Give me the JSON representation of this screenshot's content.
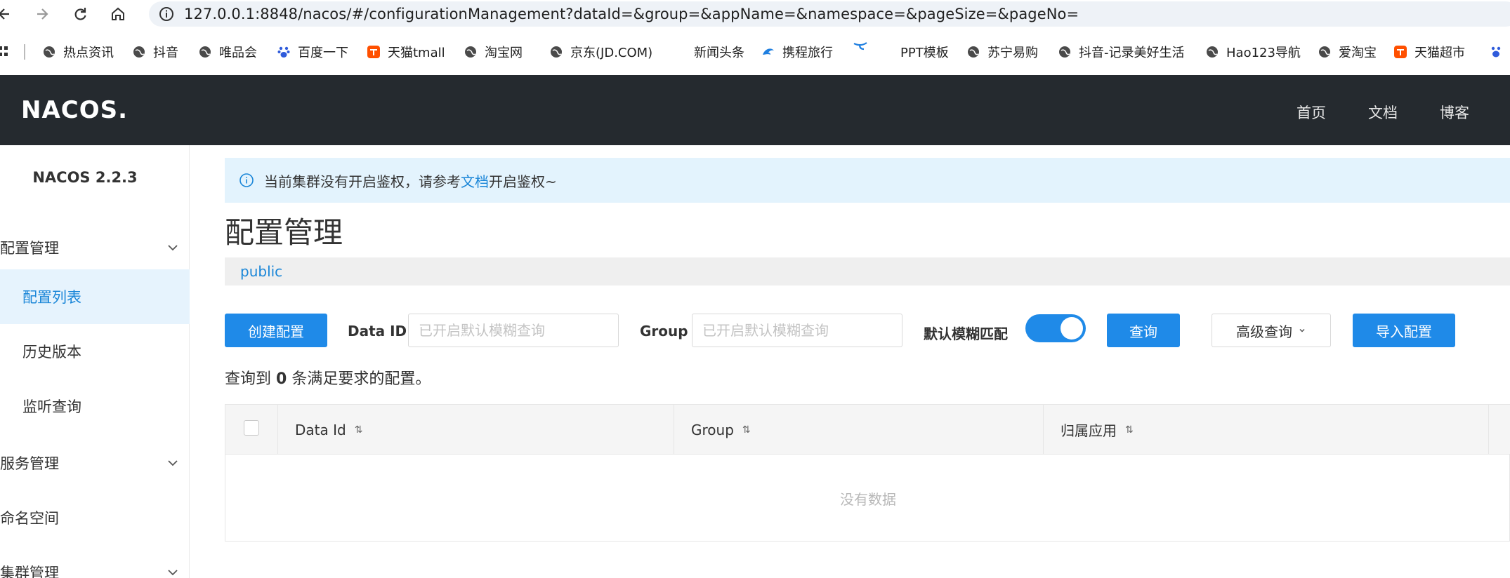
{
  "browser": {
    "url": "127.0.0.1:8848/nacos/#/configurationManagement?dataId=&group=&appName=&namespace=&pageSize=&pageNo=",
    "bookmarks": [
      "热点资讯",
      "抖音",
      "唯品会",
      "百度一下",
      "天猫tmall",
      "淘宝网",
      "京东(JD.COM)",
      "新闻头条",
      "携程旅行",
      "PPT模板",
      "苏宁易购",
      "抖音-记录美好生活",
      "Hao123导航",
      "爱淘宝",
      "天猫超市"
    ]
  },
  "header": {
    "logo": "NACOS.",
    "links": [
      "首页",
      "文档",
      "博客"
    ]
  },
  "sidebar": {
    "title": "NACOS 2.2.3",
    "sections": [
      {
        "label": "配置管理",
        "expanded": true
      },
      {
        "label": "服务管理",
        "expanded": false
      },
      {
        "label": "命名空间"
      },
      {
        "label": "集群管理",
        "expanded": false
      }
    ],
    "items": [
      "配置列表",
      "历史版本",
      "监听查询"
    ]
  },
  "notice": {
    "prefix": "当前集群没有开启鉴权，请参考",
    "link": "文档",
    "suffix": "开启鉴权~"
  },
  "main": {
    "title": "配置管理",
    "namespace": "public",
    "create_button": "创建配置",
    "data_id_label": "Data ID",
    "data_id_placeholder": "已开启默认模糊查询",
    "group_label": "Group",
    "group_placeholder": "已开启默认模糊查询",
    "fuzzy_label": "默认模糊匹配",
    "fuzzy_enabled": true,
    "query_button": "查询",
    "advanced_button": "高级查询",
    "import_button": "导入配置",
    "result_prefix": "查询到",
    "result_count": "0",
    "result_suffix": "条满足要求的配置。"
  },
  "table": {
    "columns": [
      "Data Id",
      "Group",
      "归属应用"
    ],
    "empty_text": "没有数据"
  },
  "colors": {
    "primary": "#1f8ae8",
    "header_bg": "#252a2f",
    "notice_bg": "#e3f3fd",
    "active_item_bg": "#e6f3fd"
  }
}
